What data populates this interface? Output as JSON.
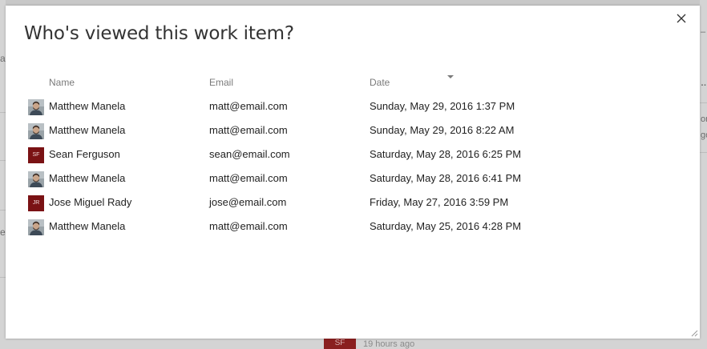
{
  "dialog": {
    "title": "Who's viewed this work item?",
    "close_icon": "close-icon",
    "columns": {
      "name": "Name",
      "email": "Email",
      "date": "Date"
    },
    "sort": {
      "column": "Date",
      "direction": "descending",
      "icon": "sort-descending-icon"
    },
    "rows": [
      {
        "name": "Matthew Manela",
        "email": "matt@email.com",
        "date": "Sunday, May 29, 2016 1:37 PM",
        "avatar": "photo"
      },
      {
        "name": "Matthew Manela",
        "email": "matt@email.com",
        "date": "Sunday, May 29, 2016 8:22 AM",
        "avatar": "photo"
      },
      {
        "name": "Sean Ferguson",
        "email": "sean@email.com",
        "date": "Saturday, May 28, 2016 6:25 PM",
        "avatar": "initials",
        "initials": "SF"
      },
      {
        "name": "Matthew Manela",
        "email": "matt@email.com",
        "date": "Saturday, May 28, 2016 6:41 PM",
        "avatar": "photo"
      },
      {
        "name": "Jose Miguel Rady",
        "email": "jose@email.com",
        "date": "Friday, May 27, 2016 3:59 PM",
        "avatar": "initials",
        "initials": "JR"
      },
      {
        "name": "Matthew Manela",
        "email": "matt@email.com",
        "date": "Saturday, May 25, 2016 4:28 PM",
        "avatar": "photo"
      }
    ]
  },
  "background": {
    "avatar_initials": "SF",
    "timestamp": "19 hours ago",
    "right_edge_glyphs": [
      "–",
      "…",
      "or",
      "go"
    ],
    "left_edge_glyphs": [
      "a",
      "e"
    ]
  },
  "colors": {
    "initials_avatar_bg": "#7a1214",
    "title_text": "#333333",
    "header_text": "#7a7a7a",
    "body_text": "#222222"
  }
}
